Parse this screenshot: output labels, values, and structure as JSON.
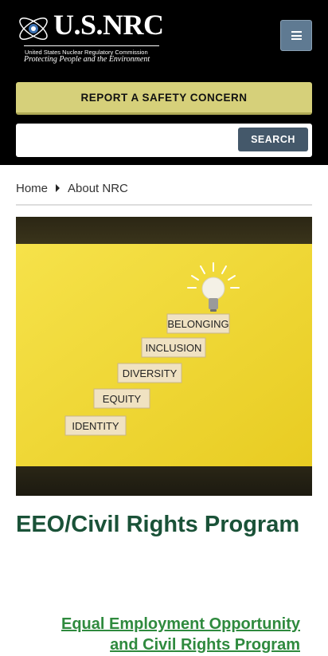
{
  "header": {
    "logo_word": "U.S.NRC",
    "logo_subtitle": "United States Nuclear Regulatory Commission",
    "logo_tagline": "Protecting People and the Environment",
    "menu_icon": "hamburger-menu-icon"
  },
  "report": {
    "label": "REPORT A SAFETY CONCERN"
  },
  "search": {
    "placeholder": "",
    "value": "",
    "button_label": "SEARCH"
  },
  "breadcrumb": {
    "items": [
      "Home",
      "About NRC"
    ]
  },
  "hero": {
    "blocks": [
      "IDENTITY",
      "EQUITY",
      "DIVERSITY",
      "INCLUSION",
      "BELONGING"
    ],
    "icon": "lightbulb-icon"
  },
  "page": {
    "title": "EEO/Civil Rights Program",
    "link_label": "Equal Employment Opportunity and Civil Rights Program"
  },
  "colors": {
    "header_bg": "#000000",
    "report_bg": "#d6d07a",
    "search_button": "#44586a",
    "title_green": "#1a5238",
    "link_green": "#2f8a3e",
    "hero_yellow": "#f3dc3a"
  }
}
